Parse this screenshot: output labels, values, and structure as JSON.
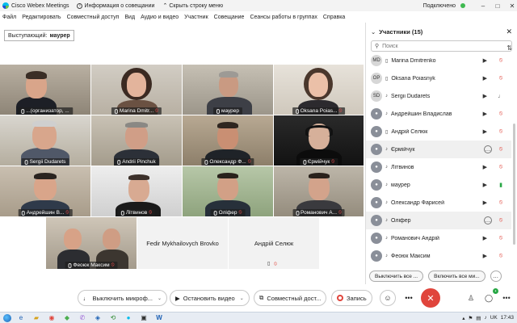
{
  "titlebar": {
    "app_title": "Cisco Webex Meetings",
    "meeting_info": "Информация о совещании",
    "hide_menu": "Скрыть строку меню",
    "status": "Подключено"
  },
  "menu": [
    "Файл",
    "Редактировать",
    "Совместный доступ",
    "Вид",
    "Аудио и видео",
    "Участник",
    "Совещание",
    "Сеансы работы в группах",
    "Справка"
  ],
  "speaker": {
    "label": "Выступающий:",
    "name": "маурер"
  },
  "tiles": [
    {
      "label": "...(организатор, ...",
      "muted": false
    },
    {
      "label": "Marina Dmitr...",
      "muted": true
    },
    {
      "label": "маурер",
      "muted": false
    },
    {
      "label": "Oksana Poias...",
      "muted": true
    },
    {
      "label": "Sergii Dudarets",
      "muted": false
    },
    {
      "label": "Andrii Pinchuk",
      "muted": false
    },
    {
      "label": "Олександр Ф...",
      "muted": true
    },
    {
      "label": "Єрмійчук",
      "muted": true
    },
    {
      "label": "Андрейшин В...",
      "muted": true
    },
    {
      "label": "Літвинов",
      "muted": true
    },
    {
      "label": "Оліфер",
      "muted": true
    },
    {
      "label": "Романович А...",
      "muted": true
    },
    {
      "label": "Феоюк Максим",
      "muted": true
    },
    {
      "label": "Fedir Mykhailovych Brovko",
      "muted": false
    },
    {
      "label": "Андрій Селюк",
      "muted": true
    }
  ],
  "panel": {
    "title": "Участники (15)",
    "search_placeholder": "Поиск",
    "participants": [
      {
        "initials": "MD",
        "name": "Marina Dmitrenko"
      },
      {
        "initials": "OP",
        "name": "Oksana Poiasnyk"
      },
      {
        "initials": "SD",
        "name": "Sergii Dudarets"
      },
      {
        "initials": "",
        "name": "Андрейшин Владислав"
      },
      {
        "initials": "",
        "name": "Андрій Селюк"
      },
      {
        "initials": "",
        "name": "Єрмійчук"
      },
      {
        "initials": "",
        "name": "Літвинов"
      },
      {
        "initials": "",
        "name": "маурер"
      },
      {
        "initials": "",
        "name": "Олександр Фарисей"
      },
      {
        "initials": "",
        "name": "Оліфер"
      },
      {
        "initials": "",
        "name": "Романович Андрій"
      },
      {
        "initials": "",
        "name": "Феоюк Максим"
      }
    ],
    "mute_all": "Выключить все ...",
    "unmute_all": "Включить все ми..."
  },
  "controls": {
    "mute": "Выключить микроф...",
    "video": "Остановить видео",
    "share": "Совместный дост...",
    "record": "Запись"
  },
  "taskbar": {
    "lang": "UK",
    "time": "17:43"
  }
}
